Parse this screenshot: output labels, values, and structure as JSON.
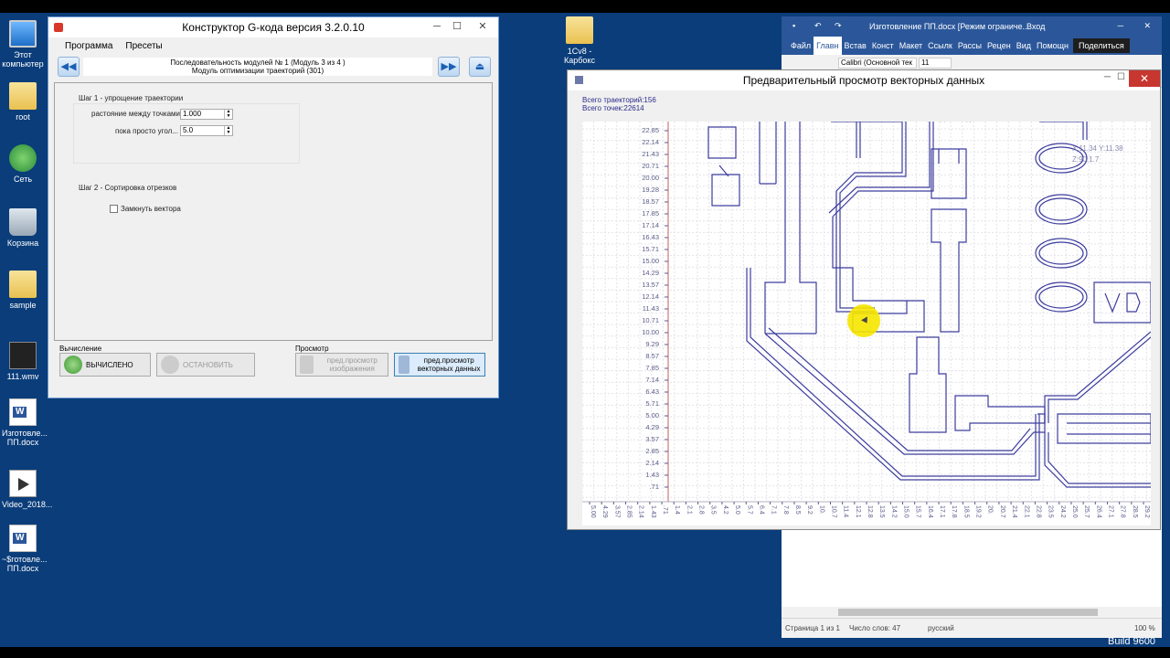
{
  "desktop": {
    "icons": [
      {
        "name": "this-pc",
        "label": "Этот компьютер",
        "icon": "computer-icon"
      },
      {
        "name": "root-folder",
        "label": "root",
        "icon": "folder-icon"
      },
      {
        "name": "network",
        "label": "Сеть",
        "icon": "network-icon"
      },
      {
        "name": "recycle-bin",
        "label": "Корзина",
        "icon": "recycle-bin-icon"
      },
      {
        "name": "sample-folder",
        "label": "sample",
        "icon": "folder-icon"
      },
      {
        "name": "video-file",
        "label": "111.wmv",
        "icon": "video-icon"
      },
      {
        "name": "doc-file",
        "label": "Изготовле... ПП.docx",
        "icon": "word-icon"
      },
      {
        "name": "video-2018",
        "label": "Video_2018...",
        "icon": "video-icon"
      },
      {
        "name": "tmp-doc",
        "label": "~$готовле... ПП.docx",
        "icon": "word-icon"
      }
    ],
    "icon_1c": {
      "label": "1Cv8 - Карбокс"
    },
    "build": "Build 9600"
  },
  "gcode": {
    "title": "Конструктор G-кода версия 3.2.0.10",
    "menu": [
      "Программа",
      "Пресеты"
    ],
    "sequence_line1": "Последовательность модулей № 1 (Модуль 3 из 4 )",
    "sequence_line2": "Модуль оптимизации траекторий (301)",
    "step1_title": "Шаг 1 - упрощение траектории",
    "dist_label": "растояние между точками",
    "dist_value": "1.000",
    "angle_label": "пока просто угол...",
    "angle_value": "5.0",
    "step2_title": "Шаг 2 - Сортировка отрезков",
    "close_vectors_label": "Замкнуть вектора",
    "calc_section": "Вычисление",
    "calc_button": "ВЫЧИСЛЕНО",
    "stop_button": "ОСТАНОВИТЬ",
    "preview_section": "Просмотр",
    "preview_image_button": "пред.просмотр изображения",
    "preview_vector_button": "пред.просмотр векторных данных"
  },
  "word": {
    "title": "Изготовление ПП.docx [Режим ограниче...",
    "login": "Вход",
    "tabs": [
      "Файл",
      "Главн",
      "Встав",
      "Конст",
      "Макет",
      "Ссылк",
      "Рассы",
      "Рецен",
      "Вид"
    ],
    "help": "Помощн",
    "share": "Поделиться",
    "font_name": "Calibri (Основной тек",
    "font_size": "11",
    "status_page": "Страница 1 из 1",
    "status_words": "Число слов: 47",
    "status_lang": "русский",
    "zoom": "100 %"
  },
  "preview": {
    "title": "Предварительный просмотр векторных данных",
    "total_paths": "Всего траекторий:156",
    "total_points": "Всего точек:22614",
    "coord_x": "X:11.34 Y:11.38",
    "coord_z": "Z:90.1.7"
  },
  "chart_data": {
    "type": "scatter",
    "y_ticks": [
      "22.85",
      "22.14",
      "21.43",
      "20.71",
      "20.00",
      "19.28",
      "18.57",
      "17.85",
      "17.14",
      "16.43",
      "15.71",
      "15.00",
      "14.29",
      "13.57",
      "12.14",
      "11.43",
      "10.71",
      "10.00",
      "9.29",
      "8.57",
      "7.85",
      "7.14",
      "6.43",
      "5.71",
      "5.00",
      "4.29",
      "3.57",
      "2.85",
      "2.14",
      "1.43",
      ".71"
    ],
    "x_ticks": [
      "5.00",
      "4.29",
      "3.57",
      "2.85",
      "2.14",
      "1.43",
      ".71",
      "1.4",
      "2.1",
      "2.8",
      "3.5",
      "4.2",
      "5.0",
      "5.7",
      "6.4",
      "7.1",
      "7.8",
      "8.5",
      "9.2",
      "10.",
      "10.7",
      "11.4",
      "12.1",
      "12.8",
      "13.5",
      "14.2",
      "15.0",
      "15.7",
      "16.4",
      "17.1",
      "17.8",
      "18.5",
      "19.2",
      "20.",
      "20.7",
      "21.4",
      "22.1",
      "22.8",
      "23.5",
      "24.2",
      "25.0",
      "25.7",
      "26.4",
      "27.1",
      "27.8",
      "28.5",
      "29.2"
    ],
    "grid": true
  },
  "colors": {
    "desktop": "#0a3d7a",
    "trace": "#3d3d9e",
    "word_blue": "#2b579a",
    "close_red": "#c7372f"
  }
}
